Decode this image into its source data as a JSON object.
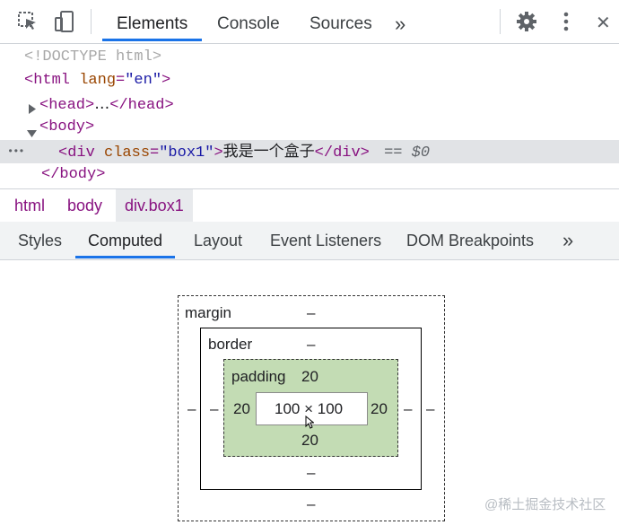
{
  "toolbar": {
    "tabs": [
      {
        "label": "Elements",
        "active": true
      },
      {
        "label": "Console",
        "active": false
      },
      {
        "label": "Sources",
        "active": false
      }
    ],
    "more_tabs_glyph": "»",
    "close_glyph": "✕"
  },
  "dom": {
    "doctype": "<!DOCTYPE html>",
    "html_open_tag": "html",
    "html_attr_name": "lang",
    "html_attr_value": "\"en\"",
    "head_tag": "head",
    "head_ellipsis": "…",
    "body_tag": "body",
    "div_tag": "div",
    "div_attr_name": "class",
    "div_attr_value": "\"box1\"",
    "div_text": "我是一个盒子",
    "selected_marker": "== $0",
    "dots": "•••"
  },
  "breadcrumbs": [
    "html",
    "body",
    "div.box1"
  ],
  "subtabs": [
    {
      "label": "Styles",
      "active": false
    },
    {
      "label": "Computed",
      "active": true
    },
    {
      "label": "Layout",
      "active": false
    },
    {
      "label": "Event Listeners",
      "active": false
    },
    {
      "label": "DOM Breakpoints",
      "active": false
    }
  ],
  "box_model": {
    "margin_label": "margin",
    "margin_top": "–",
    "margin_left": "–",
    "margin_right": "–",
    "margin_bottom": "–",
    "border_label": "border",
    "border_top": "–",
    "border_left": "–",
    "border_right": "–",
    "border_bottom": "–",
    "padding_label": "padding",
    "padding_top": "20",
    "padding_left": "20",
    "padding_right": "20",
    "padding_bottom": "20",
    "content_size": "100 × 100"
  },
  "watermark": "@稀土掘金技术社区",
  "colors": {
    "accent": "#1a73e8",
    "tag": "#881280",
    "attr": "#994500",
    "value": "#1a1aa6",
    "padding_fill": "#c3dcb4"
  }
}
